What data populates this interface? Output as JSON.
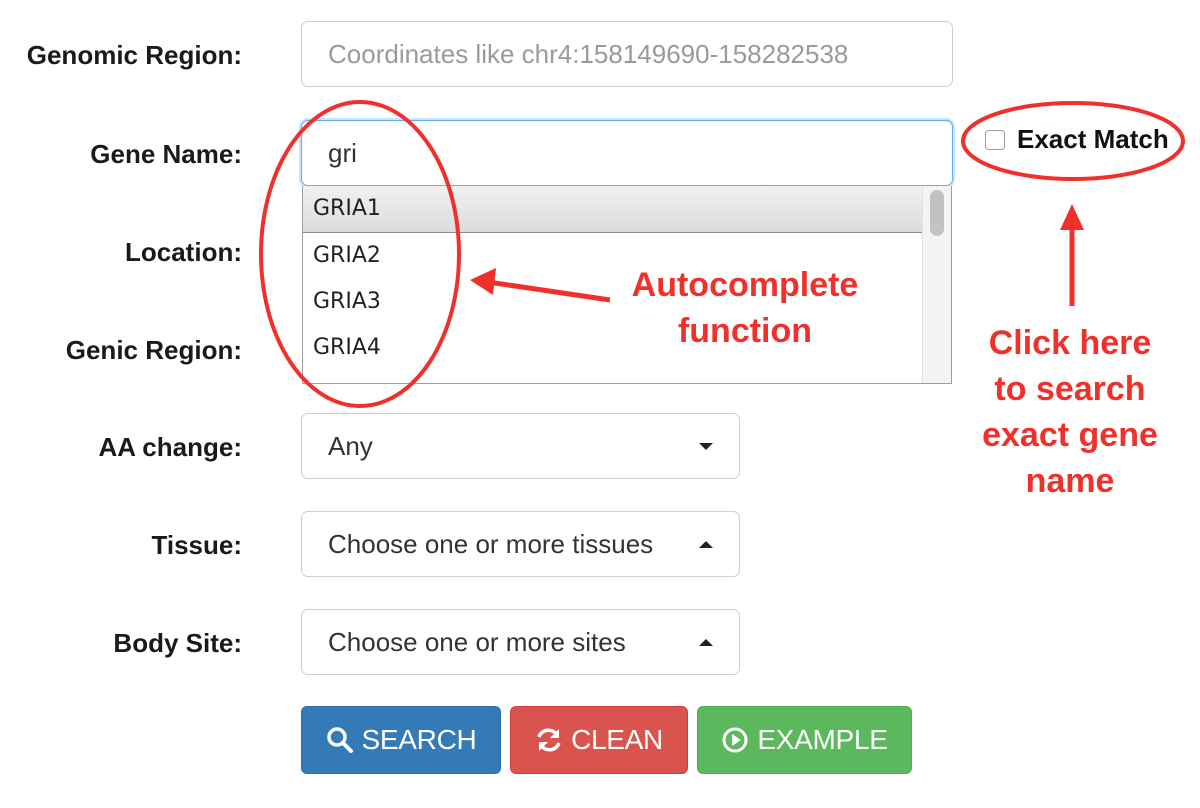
{
  "form": {
    "genomic_region": {
      "label": "Genomic Region:",
      "placeholder": "Coordinates like chr4:158149690-158282538"
    },
    "gene_name": {
      "label": "Gene Name:",
      "value": "gri"
    },
    "location": {
      "label": "Location:"
    },
    "genic_region": {
      "label": "Genic Region:"
    },
    "aa_change": {
      "label": "AA change:",
      "value": "Any"
    },
    "tissue": {
      "label": "Tissue:",
      "value": "Choose one or more tissues"
    },
    "body_site": {
      "label": "Body Site:",
      "value": "Choose one or more sites"
    },
    "exact_match": {
      "label": "Exact Match",
      "checked": false
    }
  },
  "autocomplete": {
    "items": [
      "GRIA1",
      "GRIA2",
      "GRIA3",
      "GRIA4"
    ],
    "highlighted_index": 0
  },
  "buttons": {
    "search": {
      "label": "SEARCH",
      "icon": "search-icon",
      "color": "#337ab7"
    },
    "clean": {
      "label": "CLEAN",
      "icon": "refresh-icon",
      "color": "#d9534f"
    },
    "example": {
      "label": "EXAMPLE",
      "icon": "play-circle-icon",
      "color": "#5cb85c"
    }
  },
  "annotations": {
    "autocomplete": {
      "line1": "Autocomplete",
      "line2": "function"
    },
    "exact": {
      "line1": "Click here",
      "line2": "to search",
      "line3": "exact gene",
      "line4": "name"
    },
    "color": "#f0302a"
  }
}
